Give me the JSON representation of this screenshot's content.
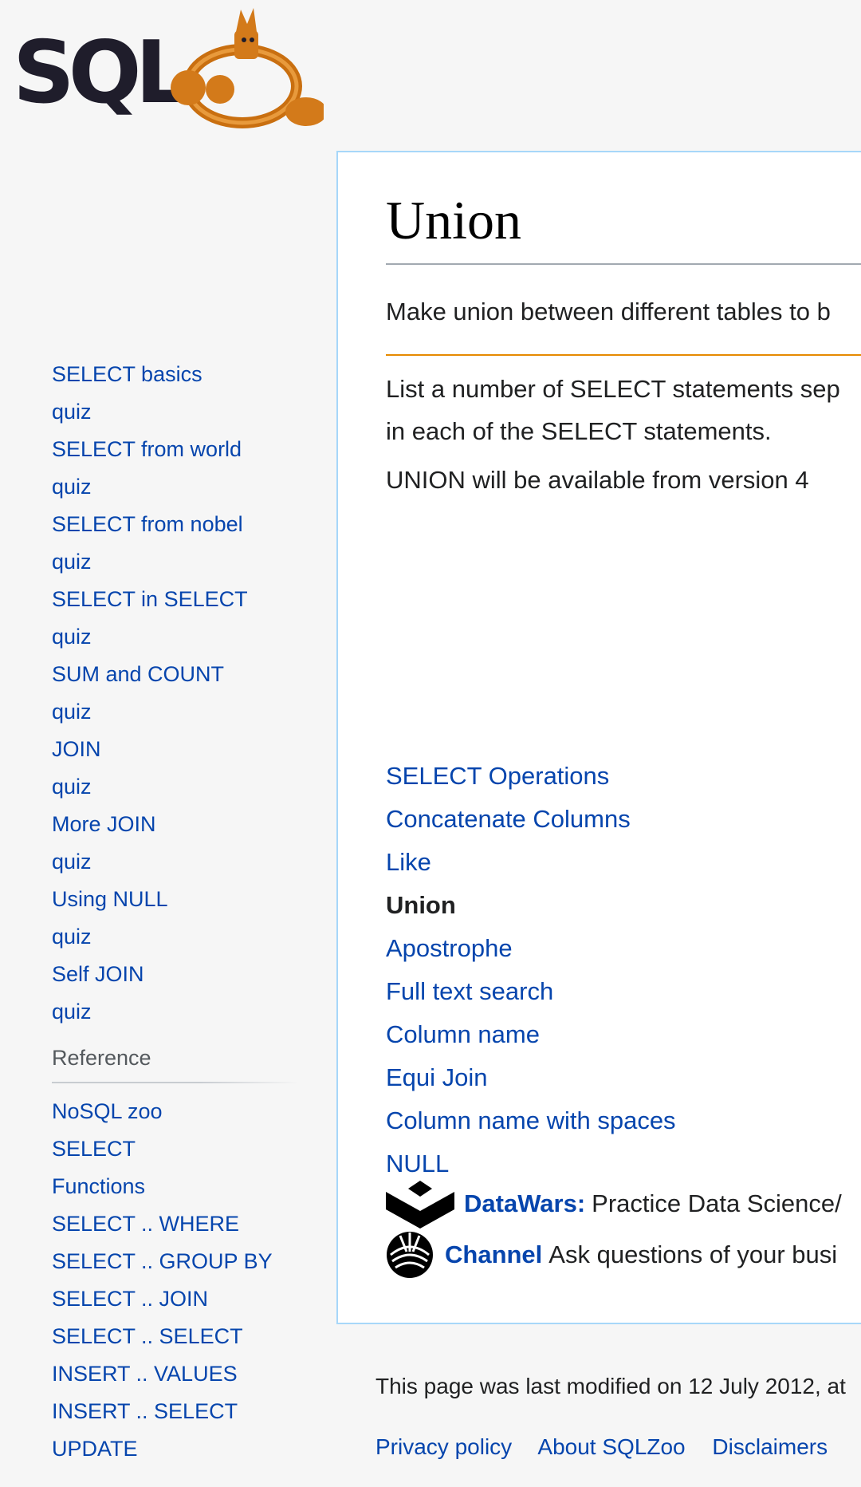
{
  "logo": {
    "text": "SQLZOO"
  },
  "sidebar": {
    "tutorials": [
      {
        "label": "SELECT basics"
      },
      {
        "label": "quiz"
      },
      {
        "label": "SELECT from world"
      },
      {
        "label": "quiz"
      },
      {
        "label": "SELECT from nobel"
      },
      {
        "label": "quiz"
      },
      {
        "label": "SELECT in SELECT"
      },
      {
        "label": "quiz"
      },
      {
        "label": "SUM and COUNT"
      },
      {
        "label": "quiz"
      },
      {
        "label": "JOIN"
      },
      {
        "label": "quiz"
      },
      {
        "label": "More JOIN"
      },
      {
        "label": "quiz"
      },
      {
        "label": "Using NULL"
      },
      {
        "label": "quiz"
      },
      {
        "label": "Self JOIN"
      },
      {
        "label": "quiz"
      }
    ],
    "reference_heading": "Reference",
    "reference": [
      {
        "label": "NoSQL zoo"
      },
      {
        "label": "SELECT"
      },
      {
        "label": "Functions"
      },
      {
        "label": "SELECT .. WHERE"
      },
      {
        "label": "SELECT .. GROUP BY"
      },
      {
        "label": "SELECT .. JOIN"
      },
      {
        "label": "SELECT .. SELECT"
      },
      {
        "label": "INSERT .. VALUES"
      },
      {
        "label": "INSERT .. SELECT"
      },
      {
        "label": "UPDATE"
      }
    ]
  },
  "content": {
    "title": "Union",
    "intro": "Make union between different tables to b",
    "para1_line1": "List a number of SELECT statements sep",
    "para1_line2": "in each of the SELECT statements.",
    "para2": "UNION will be available from version 4",
    "links": [
      {
        "label": "SELECT Operations",
        "current": false
      },
      {
        "label": "Concatenate Columns",
        "current": false
      },
      {
        "label": "Like",
        "current": false
      },
      {
        "label": "Union",
        "current": true
      },
      {
        "label": "Apostrophe",
        "current": false
      },
      {
        "label": "Full text search",
        "current": false
      },
      {
        "label": "Column name",
        "current": false
      },
      {
        "label": "Equi Join",
        "current": false
      },
      {
        "label": "Column name with spaces",
        "current": false
      },
      {
        "label": "NULL",
        "current": false
      }
    ],
    "datawars": {
      "brand": "DataWars:",
      "text": "Practice Data Science/"
    },
    "channel": {
      "brand": "Channel",
      "text": "Ask questions of your busi"
    }
  },
  "footer": {
    "modified": "This page was last modified on 12 July 2012, at",
    "links": [
      {
        "label": "Privacy policy"
      },
      {
        "label": "About SQLZoo"
      },
      {
        "label": "Disclaimers"
      }
    ]
  },
  "colors": {
    "link": "#0645ad",
    "accent": "#e68a00",
    "border": "#a7d7f9"
  }
}
